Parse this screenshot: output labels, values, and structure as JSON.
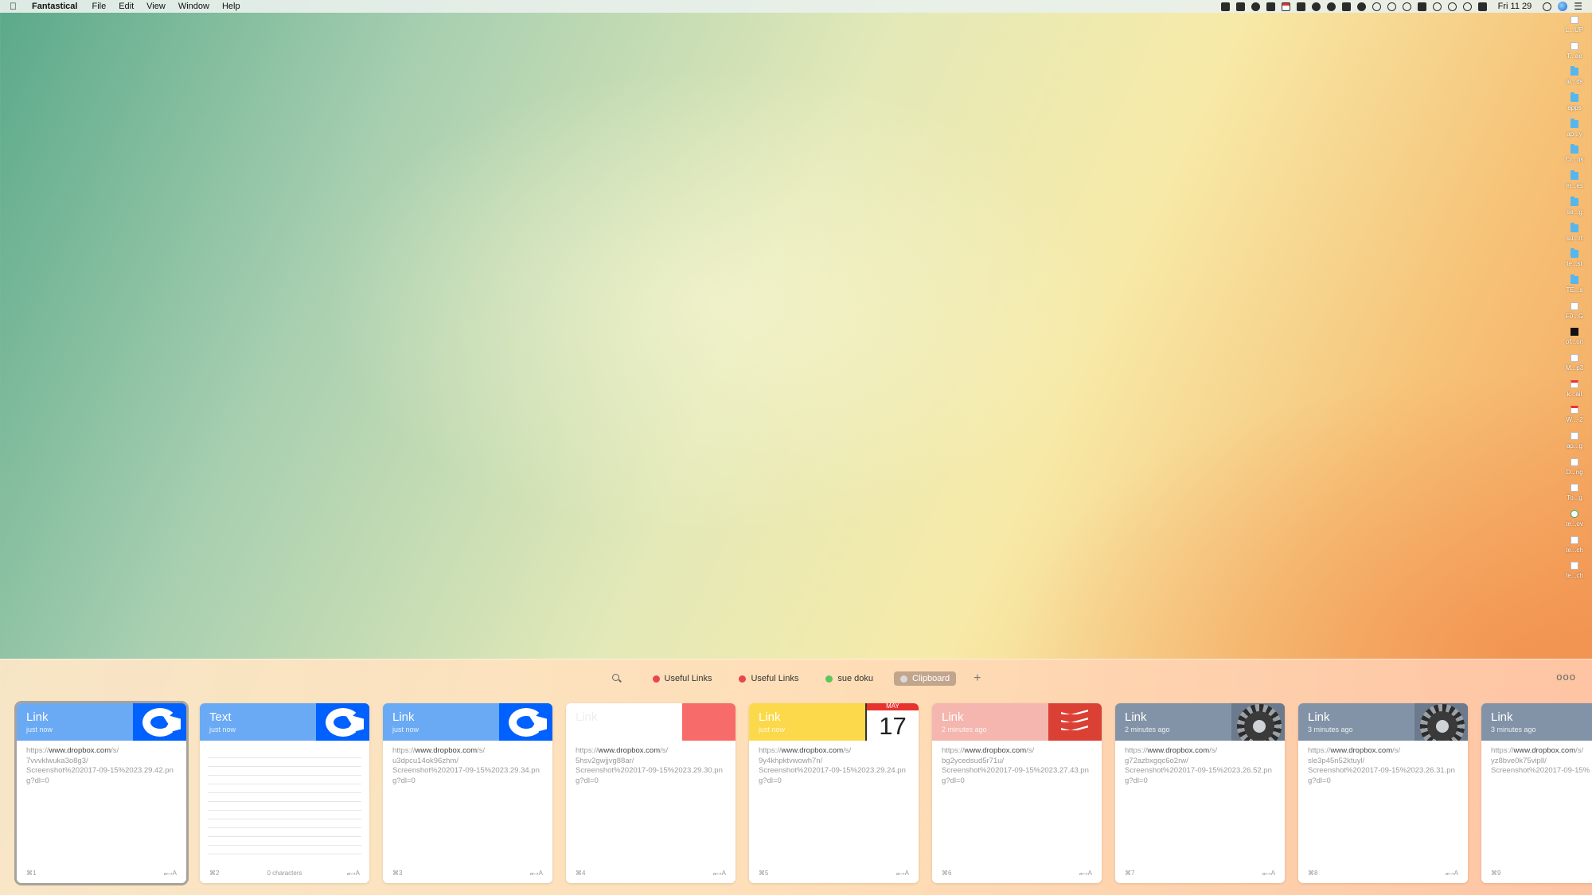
{
  "menubar": {
    "app_name": "Fantastical",
    "menus": [
      "File",
      "Edit",
      "View",
      "Window",
      "Help"
    ],
    "clock": "Fri 11 29"
  },
  "desktop": {
    "items": [
      {
        "label": "L...UP",
        "kind": "file"
      },
      {
        "label": "T...ee",
        "kind": "file"
      },
      {
        "label": "al...ds",
        "kind": "folder"
      },
      {
        "label": "apps",
        "kind": "folder"
      },
      {
        "label": "ap...y",
        "kind": "folder"
      },
      {
        "label": "Cr...ns",
        "kind": "folder"
      },
      {
        "label": "er...es",
        "kind": "folder"
      },
      {
        "label": "se...g",
        "kind": "folder"
      },
      {
        "label": "su...rt",
        "kind": "folder"
      },
      {
        "label": "te...st",
        "kind": "folder"
      },
      {
        "label": "TE...s",
        "kind": "folder"
      },
      {
        "label": "F0...G",
        "kind": "file"
      },
      {
        "label": "of...on",
        "kind": "black"
      },
      {
        "label": "M...p3",
        "kind": "file"
      },
      {
        "label": "k...ail",
        "kind": "doc"
      },
      {
        "label": "W...-2",
        "kind": "doc"
      },
      {
        "label": "ap...g",
        "kind": "file"
      },
      {
        "label": "D...ng",
        "kind": "file"
      },
      {
        "label": "To...g",
        "kind": "file"
      },
      {
        "label": "te...ov",
        "kind": "dot"
      },
      {
        "label": "te...ch",
        "kind": "file"
      },
      {
        "label": "te...ch",
        "kind": "file"
      }
    ]
  },
  "panel": {
    "pinboards": [
      {
        "label": "Useful Links",
        "color": "#e8474b",
        "active": false
      },
      {
        "label": "Useful Links",
        "color": "#e8474b",
        "active": false
      },
      {
        "label": "sue doku",
        "color": "#5dc65a",
        "active": false
      },
      {
        "label": "Clipboard",
        "color": "#d9d9d9",
        "active": true
      }
    ],
    "add_label": "+",
    "more_label": "ooo"
  },
  "cards": [
    {
      "type": "Link",
      "time": "just now",
      "header_color": "#6aaaf4",
      "thumb": "dropbox",
      "url_prefix": "https://",
      "url_domain": "www.dropbox.com",
      "url_rest": "/s/\n7vvvklwuka3o8g3/\nScreenshot%202017-09-15%2023.29.42.png?dl=0",
      "shortcut": "⌘1",
      "mid": "",
      "action": "𝒶↦A",
      "selected": true
    },
    {
      "type": "Text",
      "time": "just now",
      "header_color": "#6aaaf4",
      "thumb": "dropbox",
      "url_prefix": "",
      "url_domain": "",
      "url_rest": "",
      "shortcut": "⌘2",
      "mid": "0 characters",
      "action": "𝒶↦A",
      "selected": false
    },
    {
      "type": "Link",
      "time": "just now",
      "header_color": "#6aaaf4",
      "thumb": "dropbox",
      "url_prefix": "https://",
      "url_domain": "www.dropbox.com",
      "url_rest": "/s/\nu3dpcu14ok96zhm/\nScreenshot%202017-09-15%2023.29.34.png?dl=0",
      "shortcut": "⌘3",
      "mid": "",
      "action": "𝒶↦A",
      "selected": false
    },
    {
      "type": "Link",
      "time": "",
      "header_color": "#ffffff",
      "thumb": "red",
      "url_prefix": "https://",
      "url_domain": "www.dropbox.com",
      "url_rest": "/s/\n5hsv2gwjjvg88ar/\nScreenshot%202017-09-15%2023.29.30.png?dl=0",
      "shortcut": "⌘4",
      "mid": "",
      "action": "𝒶↦A",
      "selected": false
    },
    {
      "type": "Link",
      "time": "just now",
      "header_color": "#fcd94a",
      "thumb": "calendar",
      "cal_month": "MAY",
      "cal_day": "17",
      "url_prefix": "https://",
      "url_domain": "www.dropbox.com",
      "url_rest": "/s/\n9y4khpktvwowh7n/\nScreenshot%202017-09-15%2023.29.24.png?dl=0",
      "shortcut": "⌘5",
      "mid": "",
      "action": "𝒶↦A",
      "selected": false
    },
    {
      "type": "Link",
      "time": "2 minutes ago",
      "header_color": "#f4b6ae",
      "thumb": "todoist",
      "url_prefix": "https://",
      "url_domain": "www.dropbox.com",
      "url_rest": "/s/\nbg2ycedsud5r71u/\nScreenshot%202017-09-15%2023.27.43.png?dl=0",
      "shortcut": "⌘6",
      "mid": "",
      "action": "𝒶↦A",
      "selected": false
    },
    {
      "type": "Link",
      "time": "2 minutes ago",
      "header_color": "#8393a7",
      "thumb": "gear",
      "url_prefix": "https://",
      "url_domain": "www.dropbox.com",
      "url_rest": "/s/\ng72azbxgqc6o2rw/\nScreenshot%202017-09-15%2023.26.52.png?dl=0",
      "shortcut": "⌘7",
      "mid": "",
      "action": "𝒶↦A",
      "selected": false
    },
    {
      "type": "Link",
      "time": "3 minutes ago",
      "header_color": "#8393a7",
      "thumb": "gear",
      "url_prefix": "https://",
      "url_domain": "www.dropbox.com",
      "url_rest": "/s/\nsle3p45n52ktuyl/\nScreenshot%202017-09-15%2023.26.31.png?dl=0",
      "shortcut": "⌘8",
      "mid": "",
      "action": "𝒶↦A",
      "selected": false
    },
    {
      "type": "Link",
      "time": "3 minutes ago",
      "header_color": "#8393a7",
      "thumb": "none",
      "url_prefix": "https://",
      "url_domain": "www.dropbox.com",
      "url_rest": "/s/\nyz8bve0k75vipll/\nScreenshot%202017-09-15%",
      "shortcut": "⌘9",
      "mid": "",
      "action": "",
      "selected": false
    }
  ]
}
